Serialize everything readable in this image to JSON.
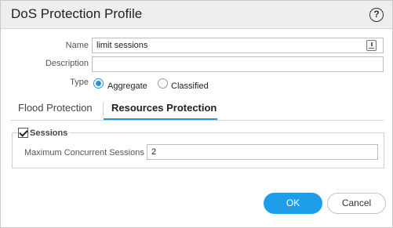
{
  "dialog": {
    "title": "DoS Protection Profile",
    "help_icon_glyph": "?"
  },
  "form": {
    "name_label": "Name",
    "name_value": "limit sessions",
    "description_label": "Description",
    "description_value": "",
    "type_label": "Type",
    "type_options": [
      {
        "label": "Aggregate",
        "selected": true
      },
      {
        "label": "Classified",
        "selected": false
      }
    ]
  },
  "tabs": [
    {
      "label": "Flood Protection",
      "active": false
    },
    {
      "label": "Resources Protection",
      "active": true
    }
  ],
  "sessions": {
    "legend": "Sessions",
    "checked": true,
    "max_concurrent_label": "Maximum Concurrent Sessions",
    "max_concurrent_value": "2"
  },
  "buttons": {
    "ok_label": "OK",
    "cancel_label": "Cancel"
  },
  "colors": {
    "accent": "#1e9ee8",
    "titlebar_bg": "#eeeeee"
  },
  "icons": {
    "help": "help-icon",
    "field_lock": "text-field-icon"
  }
}
